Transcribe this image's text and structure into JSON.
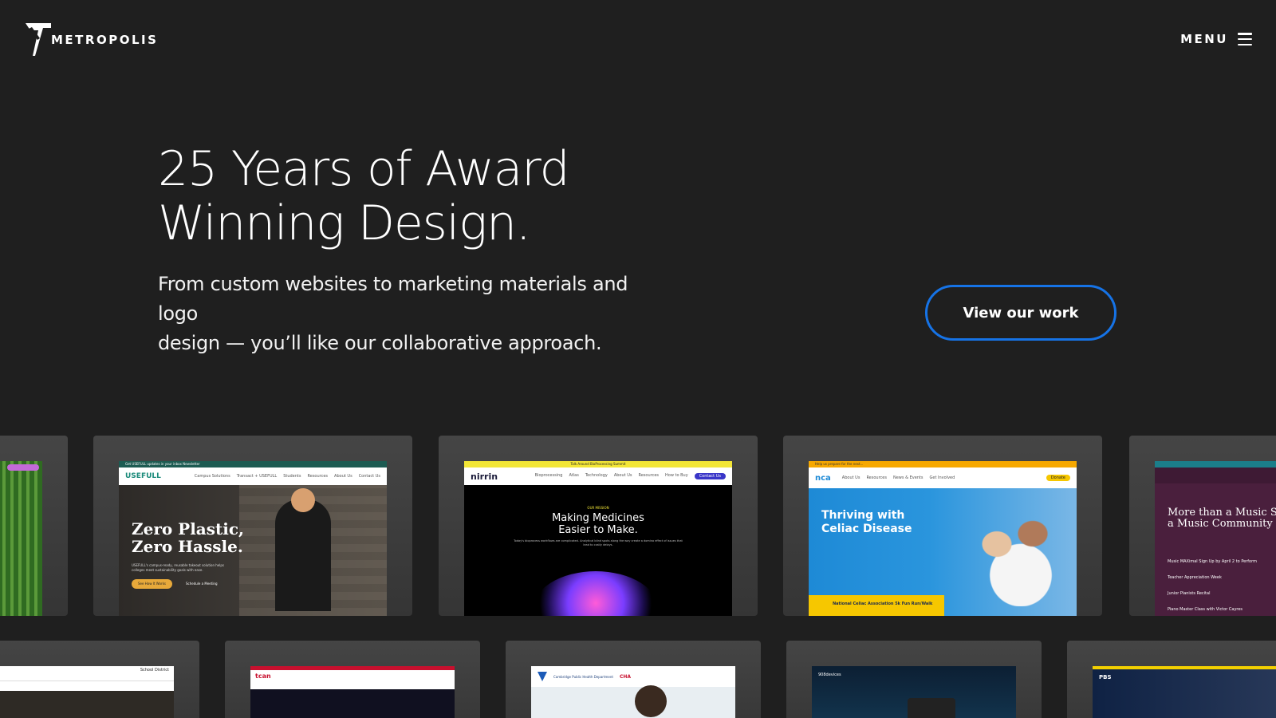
{
  "header": {
    "brand": "METROPOLIS",
    "menu_label": "MENU"
  },
  "hero": {
    "title_line1": "25 Years of Award",
    "title_line2": "Winning Design.",
    "subtitle_line1": "From custom websites to marketing materials and logo",
    "subtitle_line2": "design — you’ll like our collaborative approach.",
    "cta_label": "View our work"
  },
  "portfolio_row1": [
    {
      "id": "partial-left",
      "headline": ""
    },
    {
      "id": "usefull",
      "brand": "USEFULL",
      "topbar": "Get USEFULL updates in your inbox Newsletter",
      "nav": [
        "Campus Solutions",
        "Transact + USEFULL",
        "Students",
        "Resources",
        "About Us",
        "Contact Us"
      ],
      "headline1": "Zero Plastic,",
      "headline2": "Zero Hassle.",
      "body": "USEFULL's campus-ready, reusable takeout solution helps colleges meet sustainability goals with ease.",
      "btn1": "See How It Works",
      "btn2": "Schedule a Meeting"
    },
    {
      "id": "nirrin",
      "brand": "nirrin",
      "topbar": "Talk Around BioProcessing Summit",
      "nav": [
        "Bioprocessing",
        "Atlas",
        "Technology",
        "About Us",
        "Resources",
        "How to Buy"
      ],
      "nav_cta": "Contact Us",
      "eyebrow": "OUR MISSION",
      "headline1": "Making Medicines",
      "headline2": "Easier to Make.",
      "body": "Today's bioprocess workflows are complicated. Analytical blind spots along the way create a domino effect of issues that lead to costly delays."
    },
    {
      "id": "nca",
      "brand": "nca",
      "topbar": "Help us prepare for the next...",
      "nav": [
        "About Us",
        "Resources",
        "News & Events",
        "Get Involved"
      ],
      "nav_cta": "Donate",
      "headline1": "Thriving with",
      "headline2": "Celiac Disease",
      "event": "National Celiac Association 5k Fun Run/Walk"
    },
    {
      "id": "music-school",
      "headline1": "More than a Music Scho",
      "headline2": "a Music Community",
      "items": [
        "Music MAXimal Sign Up by April 2 to Perform",
        "Teacher Appreciation Week",
        "Junior Pianists Recital",
        "Piano Master Class with Victor Cayres"
      ]
    }
  ],
  "portfolio_row2": [
    {
      "id": "school-district",
      "brand": "School District"
    },
    {
      "id": "tcan",
      "brand": "tcan"
    },
    {
      "id": "cambridge",
      "brand": "Cambridge Public Health Department",
      "brand2": "CHA"
    },
    {
      "id": "908",
      "brand": "908devices"
    },
    {
      "id": "pbs",
      "brand": "PBS"
    }
  ],
  "colors": {
    "background": "#1f1f1f",
    "cta_border": "#1673e6",
    "card": "#3d3d3d",
    "usefull_accent": "#e8a93a",
    "nirrin_yellow": "#f3e636",
    "nca_blue": "#1e8ad6",
    "nca_yellow": "#f6c700",
    "music_purple": "#4a1f3d"
  }
}
